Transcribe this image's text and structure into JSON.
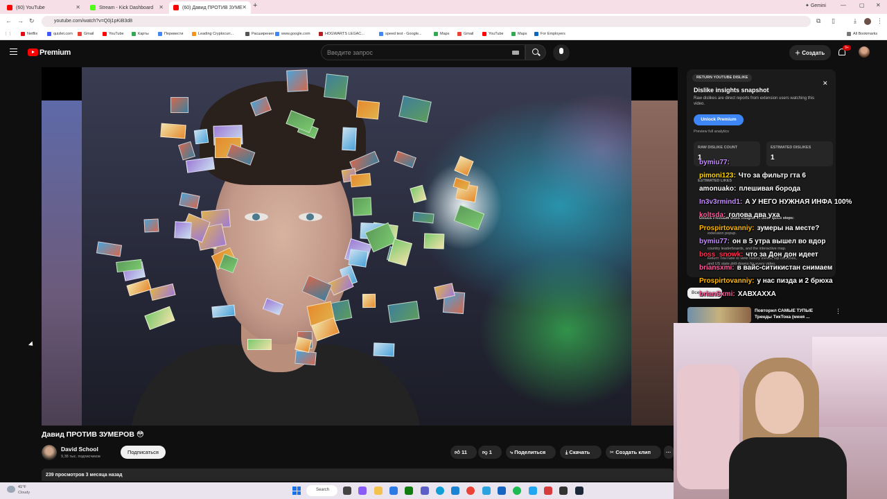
{
  "browser": {
    "tabs": [
      {
        "label": "(60) YouTube",
        "color": "#ff0000"
      },
      {
        "label": "Stream - Kick Dashboard",
        "color": "#53fc18"
      },
      {
        "label": "(60) Давид ПРОТИВ ЗУМЕ",
        "color": "#ff0000"
      }
    ],
    "gemini_label": "Gemini",
    "url": "youtube.com/watch?v=Q0j1pKiB3d8",
    "bookmarks": [
      {
        "label": "Netflix",
        "color": "#e50914"
      },
      {
        "label": "quizlet.com",
        "color": "#4255ff"
      },
      {
        "label": "Gmail",
        "color": "#ea4335"
      },
      {
        "label": "YouTube",
        "color": "#ff0000"
      },
      {
        "label": "Карты",
        "color": "#34a853"
      },
      {
        "label": "Перевести",
        "color": "#4285f4"
      },
      {
        "label": "Leading Cryptocurr...",
        "color": "#f7931a"
      },
      {
        "label": "Расширения",
        "color": "#555555"
      },
      {
        "label": "www.google.com",
        "color": "#4285f4"
      },
      {
        "label": "HOGWARTS LEGAC...",
        "color": "#b71c1c"
      },
      {
        "label": "speed test - Google...",
        "color": "#4285f4"
      },
      {
        "label": "Maps",
        "color": "#34a853"
      },
      {
        "label": "Gmail",
        "color": "#ea4335"
      },
      {
        "label": "YouTube",
        "color": "#ff0000"
      },
      {
        "label": "Maps",
        "color": "#34a853"
      },
      {
        "label": "For Employers",
        "color": "#0a66c2"
      }
    ],
    "all_bookmarks": "All Bookmarks"
  },
  "youtube": {
    "logo_text": "Premium",
    "search_placeholder": "Введите запрос",
    "create_label": "Создать",
    "notif_count": "9+"
  },
  "video": {
    "title": "Давид ПРОТИВ ЗУМЕРОВ 😳",
    "channel": "David School",
    "subscribers": "9,38 тыс. подписчиков",
    "subscribe_label": "Подписаться",
    "likes": "11",
    "dislikes": "1",
    "share_label": "Поделиться",
    "download_label": "Скачать",
    "clip_label": "Создать клип",
    "more_label": "···",
    "views_line": "239 просмотров  3 месяца назад"
  },
  "dislike_panel": {
    "badge": "RETURN YOUTUBE DISLIKE",
    "title": "Dislike insights snapshot",
    "description": "Raw dislikes are direct reports from extension users watching this video.",
    "unlock_label": "Unlock Premium",
    "preview_label": "Preview full analytics",
    "raw_label": "RAW DISLIKE COUNT",
    "raw_value": "1",
    "est_label": "ESTIMATED DISLIKES",
    "est_value": "1",
    "est_likes_label": "ESTIMATED LIKES",
    "hidden_lines": [
      "Unlock Premium video insights in three quick steps:",
      "extension popup.",
      "country leaderboards, and the interactive map.",
      "Return YouTube to view history trends, top countries,",
      "and US state drill-downs for every video."
    ]
  },
  "chat": [
    {
      "user": "bymiu77:",
      "color": "#c58cff",
      "msg": ""
    },
    {
      "user": "pimoni123:",
      "color": "#ffd400",
      "msg": "Что за фильтр гта 6"
    },
    {
      "user": "amonuako:",
      "color": "#ffffff",
      "msg": "плешивая борода"
    },
    {
      "user": "In3v3rmind1:",
      "color": "#c58cff",
      "msg": "А У НЕГО НУЖНАЯ ИНФА 100%"
    },
    {
      "user": "koltsda:",
      "color": "#ff5a9c",
      "msg": "голова два уха"
    },
    {
      "user": "Prospirtovanniy:",
      "color": "#ffb800",
      "msg": "зумеры на месте?"
    },
    {
      "user": "bymiu77:",
      "color": "#c58cff",
      "msg": "он в 5 утра вышел во вдор"
    },
    {
      "user": "boss_snowk:",
      "color": "#ff2e4d",
      "msg": "что за Дон дон идеет"
    },
    {
      "user": "briansxmi:",
      "color": "#ff5a9c",
      "msg": "в вайс-ситикистан снимаем"
    },
    {
      "user": "Prospirtovanniy:",
      "color": "#ffb800",
      "msg": "у нас пизда и 2 брюха"
    },
    {
      "user": "brianSxmi:",
      "color": "#ff5a9c",
      "msg": "ХАВХАХХА"
    }
  ],
  "sidebar": {
    "filter_label": "Все",
    "rec_title": "Повторил САМЫЕ ТУПЫЕ Тренды ТикТока (меня ..."
  },
  "taskbar": {
    "temp": "41°F",
    "weather": "Cloudy",
    "search_label": "Search"
  }
}
